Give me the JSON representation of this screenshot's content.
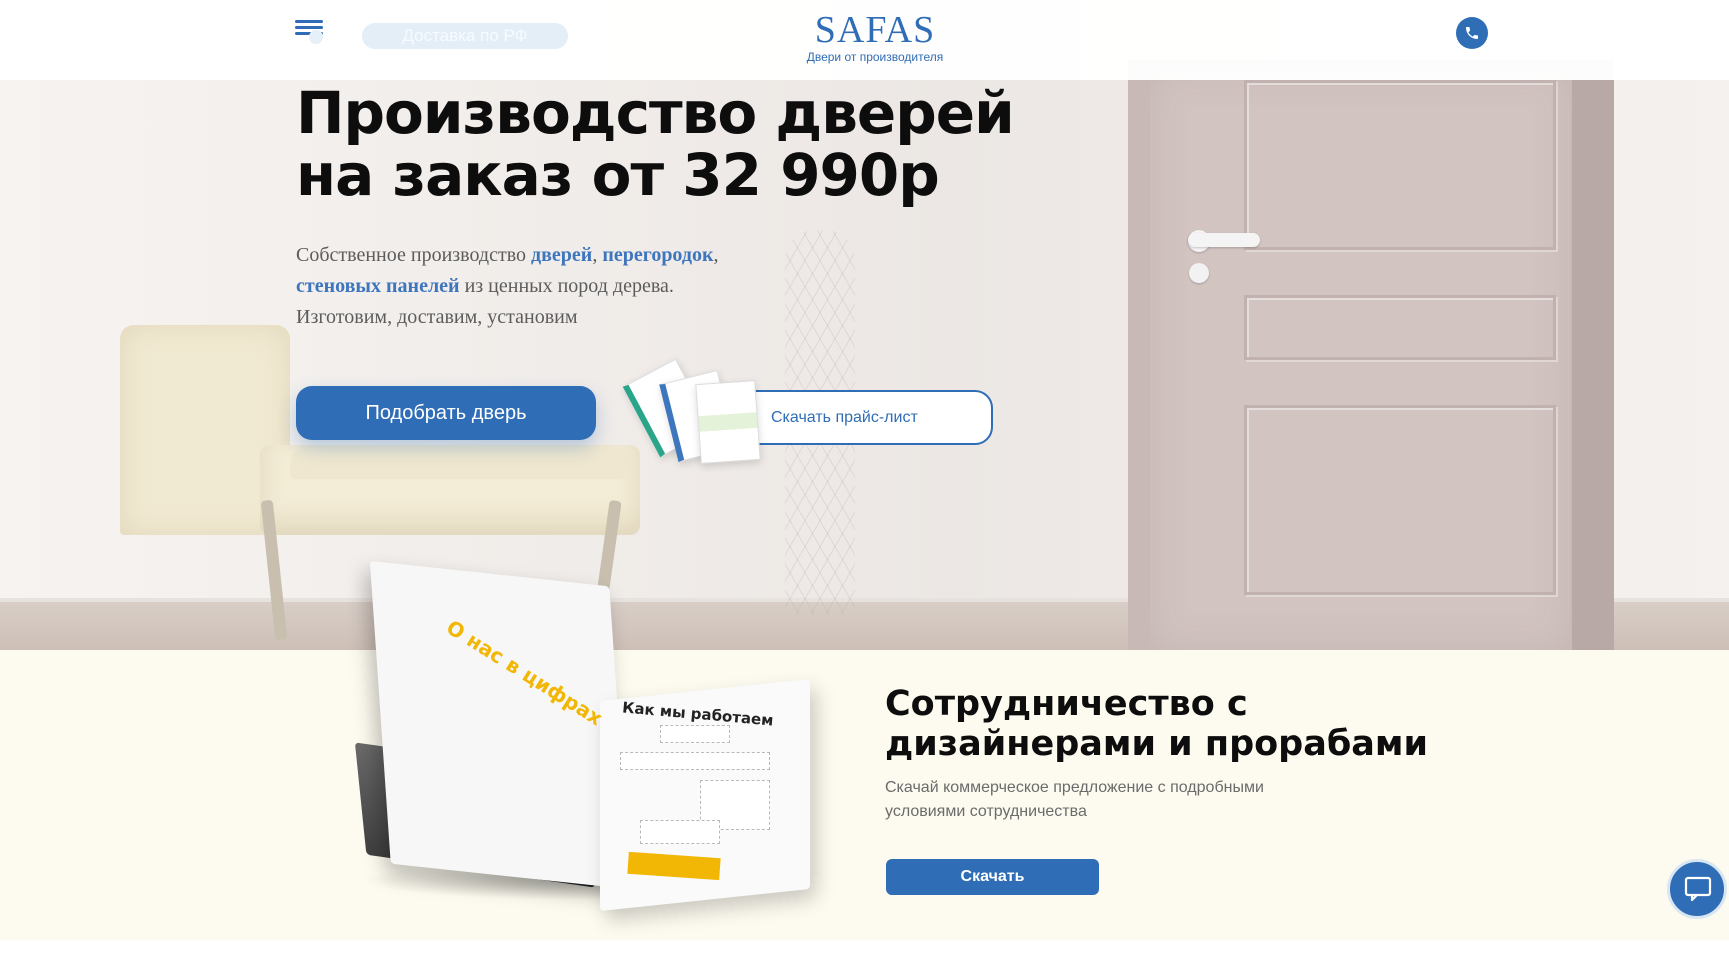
{
  "header": {
    "delivery_label": "Доставка по РФ",
    "logo_title": "SAFAS",
    "logo_subtitle": "Двери от производителя"
  },
  "hero": {
    "title": "Производство дверей на заказ от 32 990р",
    "desc_prefix": "Собственное производство ",
    "link_doors": "дверей",
    "link_partitions": "перегородок",
    "link_panels": "стеновых панелей",
    "desc_suffix": " из ценных пород дерева.",
    "desc_line3": "Изготовим, доставим, установим",
    "primary_button": "Подобрать дверь",
    "price_button": "Скачать прайс-лист"
  },
  "cooperation": {
    "title": "Сотрудничество с дизайнерами и прорабами",
    "description": "Скачай коммерческое предложение с подробными условиями сотрудничества",
    "download_button": "Скачать",
    "booklet_heading_left": "О нас в цифрах",
    "booklet_heading_right": "Как мы работаем"
  },
  "icons": {
    "menu": "menu-icon",
    "phone": "phone-icon",
    "chat": "chat-icon"
  },
  "colors": {
    "accent": "#2f6db6",
    "booklet_accent": "#f2b705",
    "section_bg": "#fdfbef"
  }
}
